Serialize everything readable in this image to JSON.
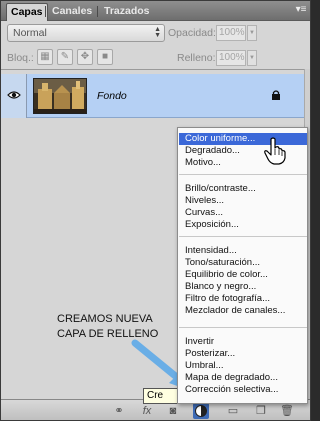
{
  "tabs": {
    "items": [
      {
        "label": "Capas"
      },
      {
        "label": "Canales"
      },
      {
        "label": "Trazados"
      }
    ],
    "menu_glyph": "▾≡"
  },
  "blend": {
    "mode": "Normal",
    "opacity_label": "Opacidad:",
    "opacity_value": "100%"
  },
  "lock": {
    "label": "Bloq.:",
    "fill_label": "Relleno:",
    "fill_value": "100%"
  },
  "layers": [
    {
      "name": "Fondo",
      "visible": true,
      "locked": true
    }
  ],
  "menu": {
    "groups": [
      [
        "Color uniforme...",
        "Degradado...",
        "Motivo..."
      ],
      [
        "Brillo/contraste...",
        "Niveles...",
        "Curvas...",
        "Exposición..."
      ],
      [
        "Intensidad...",
        "Tono/saturación...",
        "Equilibrio de color...",
        "Blanco y negro...",
        "Filtro de fotografía...",
        "Mezclador de canales..."
      ],
      [
        "Invertir",
        "Posterizar...",
        "Umbral...",
        "Mapa de degradado...",
        "Corrección selectiva..."
      ]
    ],
    "highlighted": "Color uniforme...",
    "highlight_color": "#3b68d8"
  },
  "caption": {
    "line1": "CREAMOS NUEVA",
    "line2": "CAPA DE RELLENO"
  },
  "tooltip": "Cre",
  "bottom_icons": [
    "link-icon",
    "fx-icon",
    "mask-icon",
    "adjustment-layer-icon",
    "folder-icon",
    "new-layer-icon",
    "trash-icon"
  ],
  "colors": {
    "selected_layer": "#b5d0f4",
    "arrow": "#6aaee6"
  }
}
